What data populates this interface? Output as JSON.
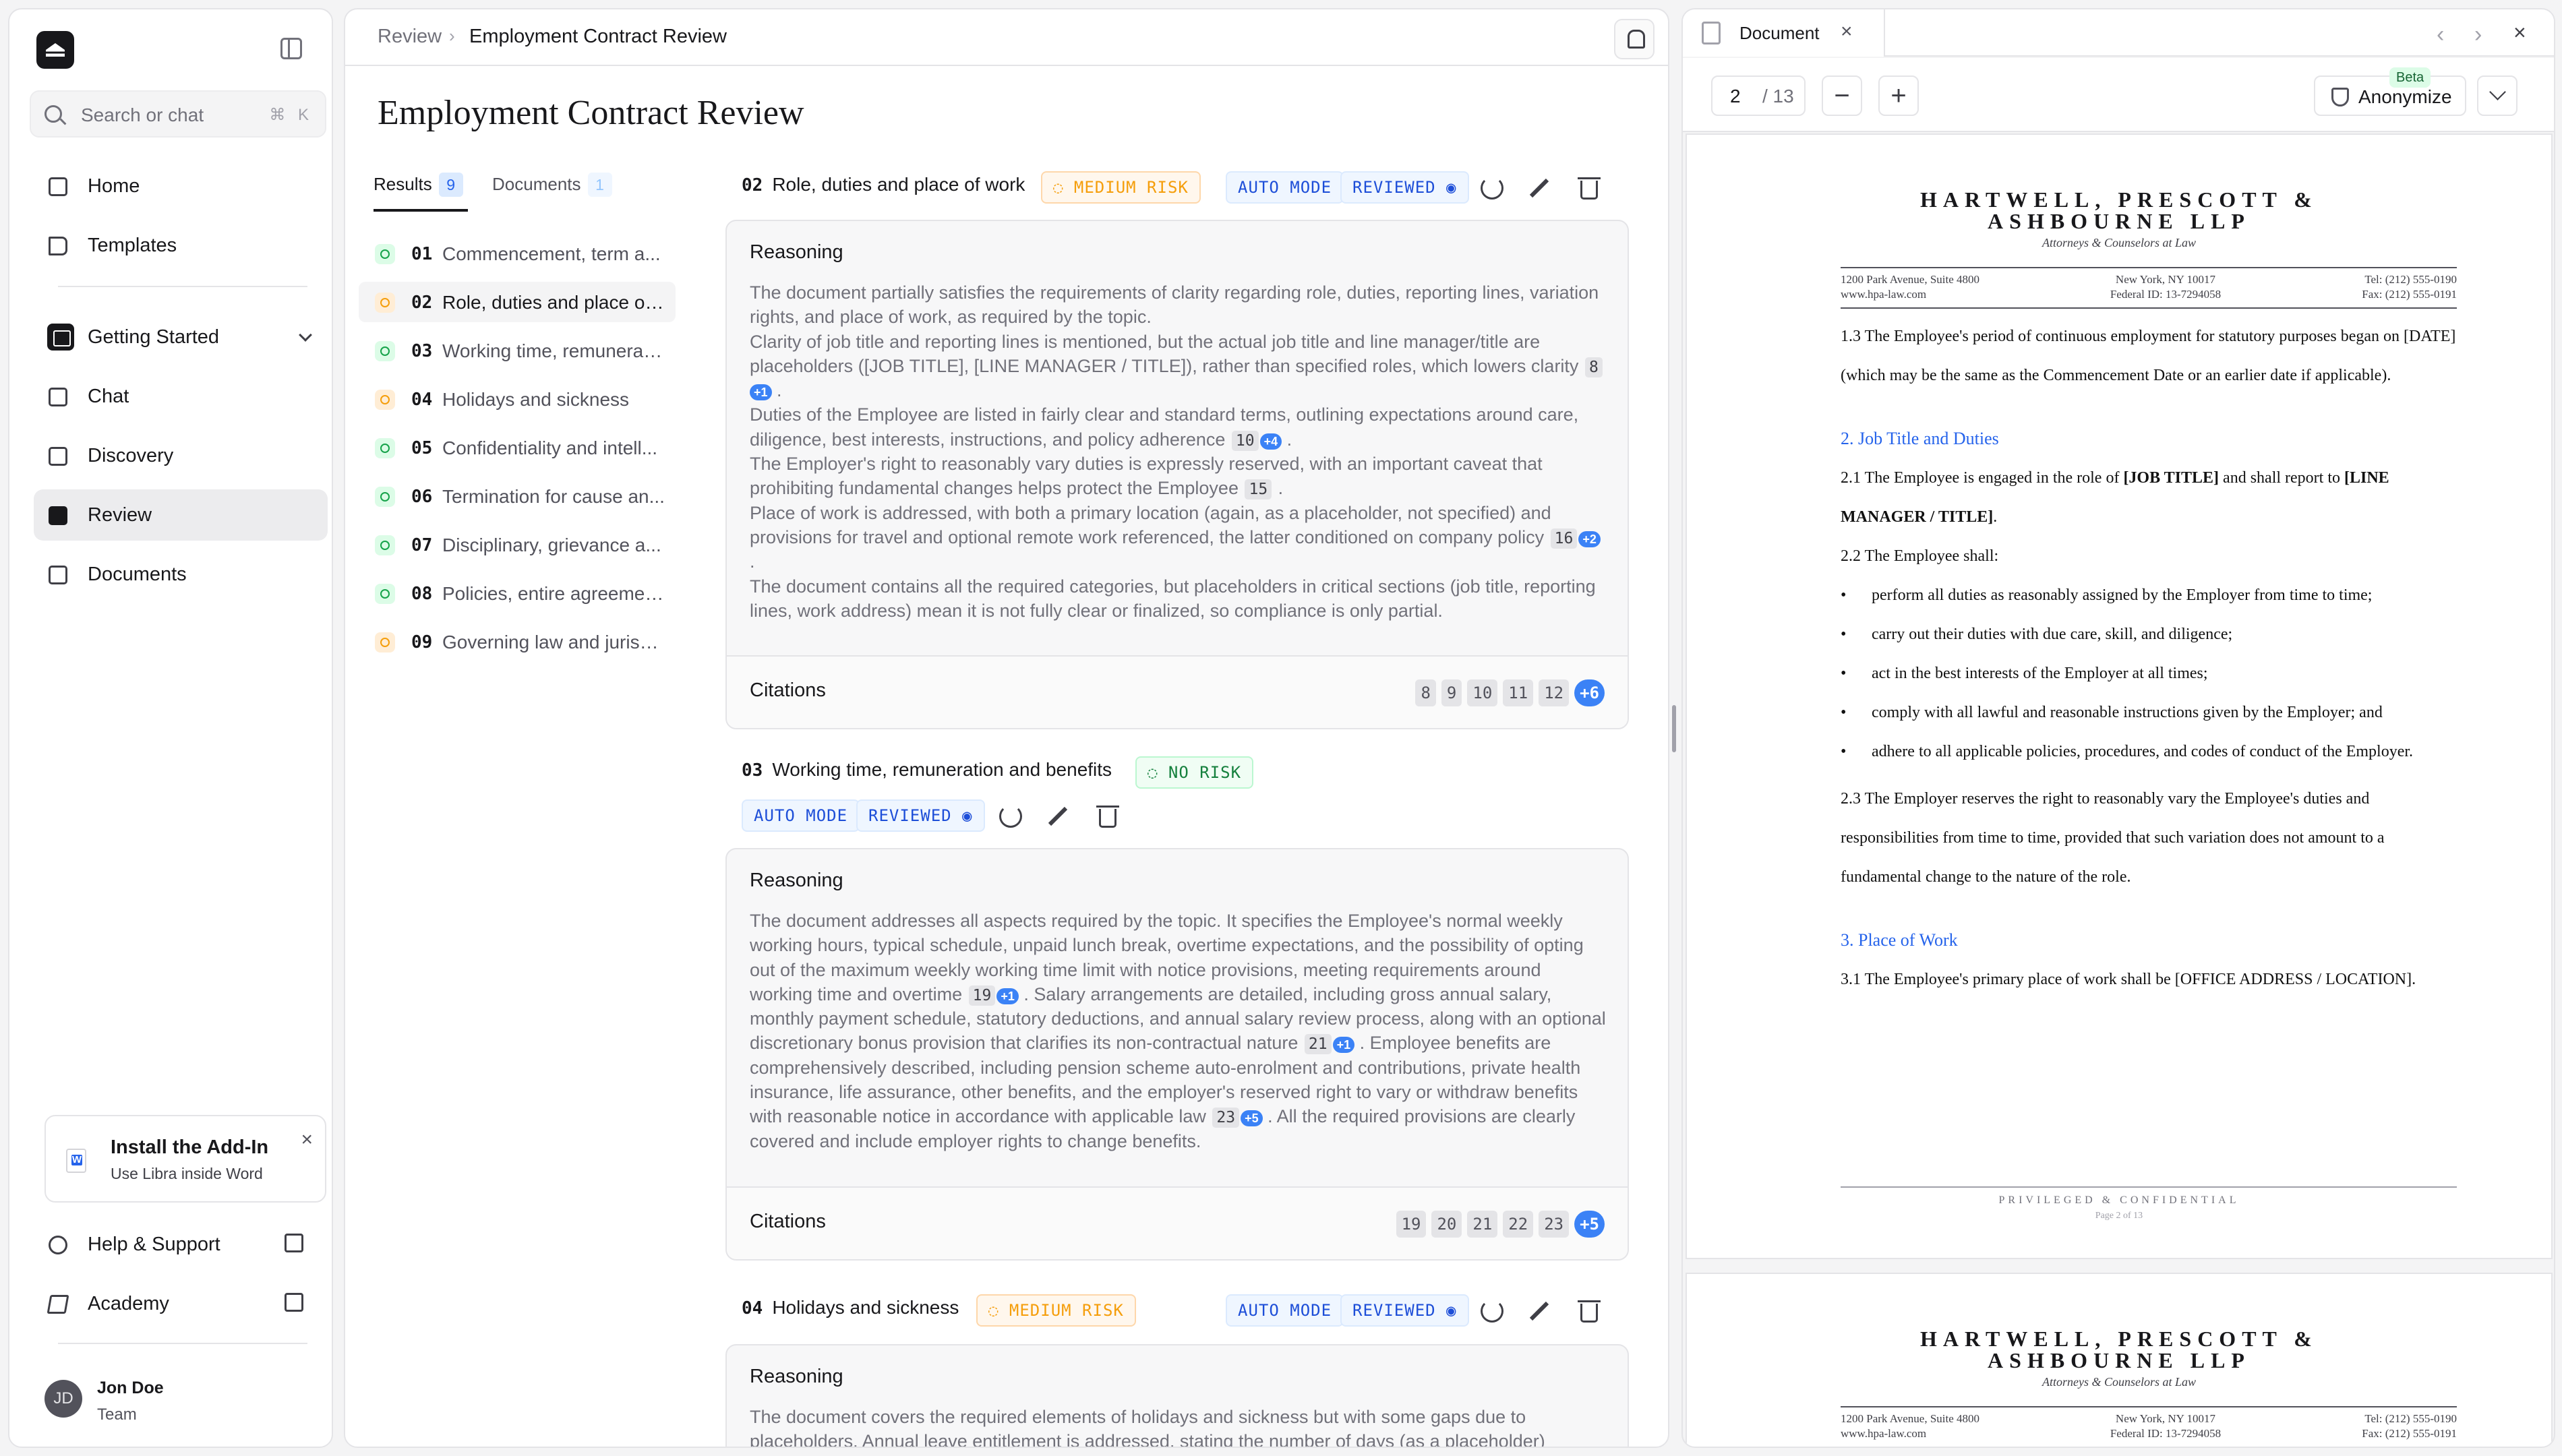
{
  "sidebar": {
    "search_placeholder": "Search or chat",
    "search_shortcut": "⌘ K",
    "nav": {
      "home": "Home",
      "templates": "Templates",
      "getting_started": "Getting Started",
      "chat": "Chat",
      "discovery": "Discovery",
      "review": "Review",
      "documents": "Documents"
    },
    "addin": {
      "title": "Install the Add-In",
      "subtitle": "Use Libra inside Word"
    },
    "help": "Help & Support",
    "academy": "Academy",
    "user": {
      "initials": "JD",
      "name": "Jon Doe",
      "role": "Team"
    }
  },
  "main": {
    "breadcrumb": {
      "parent": "Review",
      "current": "Employment Contract Review"
    },
    "title": "Employment Contract Review",
    "tabs": {
      "results": "Results",
      "results_count": "9",
      "documents": "Documents",
      "documents_count": "1"
    },
    "items": [
      {
        "num": "01",
        "label": "Commencement, term a...",
        "risk": "none"
      },
      {
        "num": "02",
        "label": "Role, duties and place of ...",
        "risk": "medium"
      },
      {
        "num": "03",
        "label": "Working time, remunerati...",
        "risk": "none"
      },
      {
        "num": "04",
        "label": "Holidays and sickness",
        "risk": "medium"
      },
      {
        "num": "05",
        "label": "Confidentiality and intell...",
        "risk": "none"
      },
      {
        "num": "06",
        "label": "Termination for cause an...",
        "risk": "none"
      },
      {
        "num": "07",
        "label": "Disciplinary, grievance a...",
        "risk": "none"
      },
      {
        "num": "08",
        "label": "Policies, entire agreemen...",
        "risk": "none"
      },
      {
        "num": "09",
        "label": "Governing law and jurisdi...",
        "risk": "medium"
      }
    ],
    "labels": {
      "reasoning": "Reasoning",
      "citations": "Citations",
      "auto_mode": "AUTO MODE",
      "reviewed": "REVIEWED",
      "medium_risk": "MEDIUM RISK",
      "no_risk": "NO RISK"
    },
    "sections": [
      {
        "num": "02",
        "title": "Role, duties and place of work",
        "citations": [
          "8",
          "9",
          "10",
          "11",
          "12",
          "+6"
        ]
      },
      {
        "num": "03",
        "title": "Working time, remuneration and benefits",
        "citations": [
          "19",
          "20",
          "21",
          "22",
          "23",
          "+5"
        ]
      },
      {
        "num": "04",
        "title": "Holidays and sickness",
        "reasoning": "The document covers the required elements of holidays and sickness but with some gaps due to placeholders. Annual leave entitlement is addressed, stating the number of days (as a placeholder)"
      }
    ]
  },
  "viewer": {
    "tab_title": "Document",
    "page_current": "2",
    "page_total": "/ 13",
    "anonymize": "Anonymize",
    "beta": "Beta",
    "firm_line1": "HARTWELL, PRESCOTT &",
    "firm_line2": "ASHBOURNE LLP",
    "firm_sub": "Attorneys & Counselors at Law",
    "addr_left": [
      "1200 Park Avenue, Suite 4800",
      "www.hpa-law.com"
    ],
    "addr_center": [
      "New York, NY 10017",
      "Federal ID: 13-7294058"
    ],
    "addr_right": [
      "Tel: (212) 555-0190",
      "Fax: (212) 555-0191"
    ],
    "p13": "1.3 The Employee's period of continuous employment for statutory purposes began on [DATE] (which may be the same as the Commencement Date or an earlier date if applicable).",
    "h2": "2. Job Title and Duties",
    "p21a": "2.1 The Employee is engaged in the role of ",
    "p21b": "[JOB TITLE]",
    "p21c": " and shall report to ",
    "p21d": "[LINE MANAGER / TITLE]",
    "p21e": ".",
    "p22": "2.2 The Employee shall:",
    "bullets": [
      "perform all duties as reasonably assigned by the Employer from time to time;",
      "carry out their duties with due care, skill, and diligence;",
      "act in the best interests of the Employer at all times;",
      "comply with all lawful and reasonable instructions given by the Employer; and",
      "adhere to all applicable policies, procedures, and codes of conduct of the Employer."
    ],
    "p23": "2.3 The Employer reserves the right to reasonably vary the Employee's duties and responsibilities from time to time, provided that such variation does not amount to a fundamental change to the nature of the role.",
    "h3": "3. Place of Work",
    "p31": "3.1 The Employee's primary place of work shall be [OFFICE ADDRESS / LOCATION].",
    "footer": "PRIVILEGED & CONFIDENTIAL",
    "footer_page": "Page 2 of 13"
  },
  "colors": {
    "accent_blue": "#2563eb",
    "risk_medium": "#f59e0b",
    "risk_none": "#16a34a"
  }
}
